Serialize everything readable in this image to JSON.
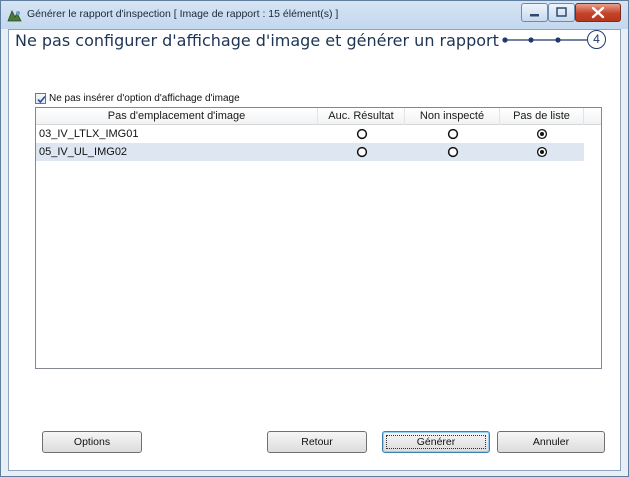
{
  "window": {
    "title": "Générer le rapport d'inspection  [ Image de rapport : 15 élément(s) ]",
    "controls": {
      "minimize": "minimize",
      "maximize": "maximize",
      "close": "close"
    }
  },
  "heading": "Ne pas configurer d'affichage d'image et générer un rapport",
  "stepper": {
    "current_step": "4",
    "total_steps": 4
  },
  "option": {
    "label": "Ne pas insérer d'option d'affichage d'image",
    "checked": true
  },
  "table": {
    "columns": [
      "Pas d'emplacement d'image",
      "Auc. Résultat",
      "Non inspecté",
      "Pas de liste"
    ],
    "rows": [
      {
        "name": "03_IV_LTLX_IMG01",
        "selected": "Pas de liste"
      },
      {
        "name": "05_IV_UL_IMG02",
        "selected": "Pas de liste"
      }
    ]
  },
  "buttons": {
    "options": "Options",
    "back": "Retour",
    "generate": "Générer",
    "cancel": "Annuler"
  },
  "colors": {
    "titlebar": "#c3d7ee",
    "heading": "#1e3454",
    "row_alt": "#dde6f1",
    "close_button": "#c4432a"
  }
}
